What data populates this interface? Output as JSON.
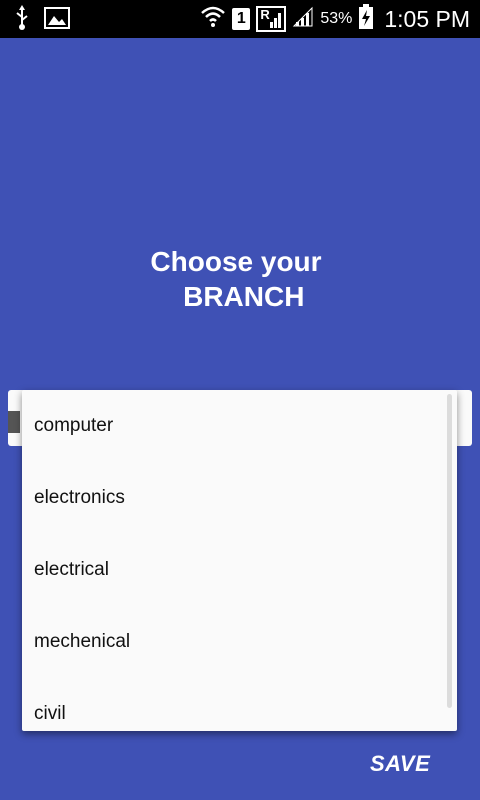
{
  "status_bar": {
    "sim_slot": "1",
    "roaming_indicator": "R",
    "battery": "53%",
    "time": "1:05 PM",
    "icons": [
      "usb-icon",
      "image-icon",
      "wifi-icon",
      "sim-icon",
      "signal-roaming-icon",
      "signal-icon",
      "battery-charging-icon"
    ]
  },
  "header": {
    "line1": "Choose your",
    "line2": "  BRANCH"
  },
  "branch_spinner": {
    "options": [
      "computer",
      "electronics",
      "electrical",
      "mechenical",
      "civil"
    ]
  },
  "actions": {
    "save_label": "SAVE"
  },
  "colors": {
    "background": "#3f51b5",
    "status_bar": "#000000",
    "popup": "#fafafa"
  }
}
